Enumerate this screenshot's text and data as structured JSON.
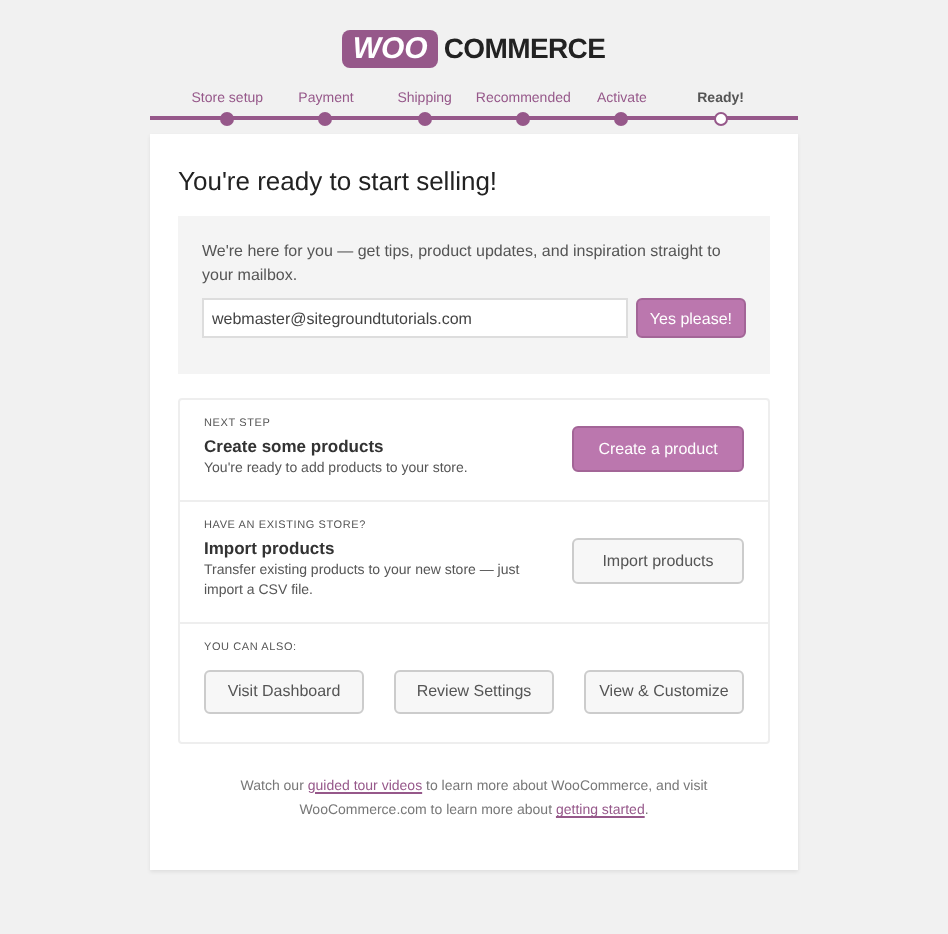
{
  "logo": {
    "badge": "WOO",
    "word": "COMMERCE"
  },
  "steps": [
    {
      "label": "Store setup",
      "selected": false
    },
    {
      "label": "Payment",
      "selected": false
    },
    {
      "label": "Shipping",
      "selected": false
    },
    {
      "label": "Recommended",
      "selected": false
    },
    {
      "label": "Activate",
      "selected": false
    },
    {
      "label": "Ready!",
      "selected": true
    }
  ],
  "title": "You're ready to start selling!",
  "newsletter": {
    "text": "We're here for you — get tips, product updates, and inspiration straight to your mailbox.",
    "email": "webmaster@sitegroundtutorials.com",
    "button": "Yes please!"
  },
  "next_steps": [
    {
      "eyebrow": "NEXT STEP",
      "heading": "Create some products",
      "text": "You're ready to add products to your store.",
      "button": "Create a product",
      "kind": "primary"
    },
    {
      "eyebrow": "HAVE AN EXISTING STORE?",
      "heading": "Import products",
      "text": "Transfer existing products to your new store — just import a CSV file.",
      "button": "Import products",
      "kind": "secondary"
    }
  ],
  "also": {
    "eyebrow": "YOU CAN ALSO:",
    "buttons": [
      "Visit Dashboard",
      "Review Settings",
      "View & Customize"
    ]
  },
  "footer": [
    {
      "text": "Watch our ",
      "link": false
    },
    {
      "text": "guided tour videos",
      "link": true
    },
    {
      "text": " to learn more about WooCommerce, and visit WooCommerce.com to learn more about ",
      "link": false
    },
    {
      "text": "getting started",
      "link": true
    },
    {
      "text": ".",
      "link": false
    }
  ]
}
